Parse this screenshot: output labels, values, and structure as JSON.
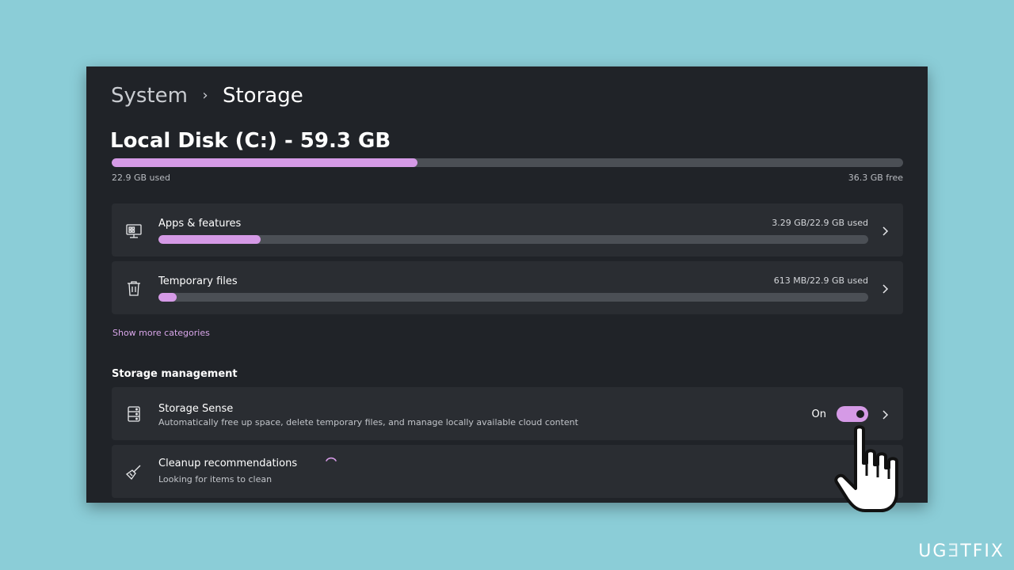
{
  "breadcrumb": {
    "parent": "System",
    "separator": "›",
    "current": "Storage"
  },
  "disk": {
    "title": "Local Disk (C:) - 59.3 GB",
    "used_label": "22.9 GB used",
    "free_label": "36.3 GB free",
    "used_fraction": 0.386
  },
  "categories": [
    {
      "title": "Apps & features",
      "usage": "3.29 GB/22.9 GB used",
      "fill_fraction": 0.144,
      "icon": "apps-features-icon"
    },
    {
      "title": "Temporary files",
      "usage": "613 MB/22.9 GB used",
      "fill_fraction": 0.026,
      "icon": "trash-icon"
    }
  ],
  "show_more": "Show more categories",
  "storage_management": {
    "heading": "Storage management",
    "storage_sense": {
      "title": "Storage Sense",
      "description": "Automatically free up space, delete temporary files, and manage locally available cloud content",
      "toggle_label": "On",
      "toggle_on": true,
      "icon": "storage-drive-icon"
    },
    "cleanup": {
      "title": "Cleanup recommendations",
      "description": "Looking for items to clean",
      "icon": "broom-icon"
    }
  },
  "colors": {
    "accent": "#d59ae6",
    "background": "#8bcdd7",
    "window": "#202328",
    "card": "#2a2d32"
  },
  "watermark": {
    "prefix": "UG",
    "accent": "Ǝ",
    "suffix": "TFIX"
  }
}
